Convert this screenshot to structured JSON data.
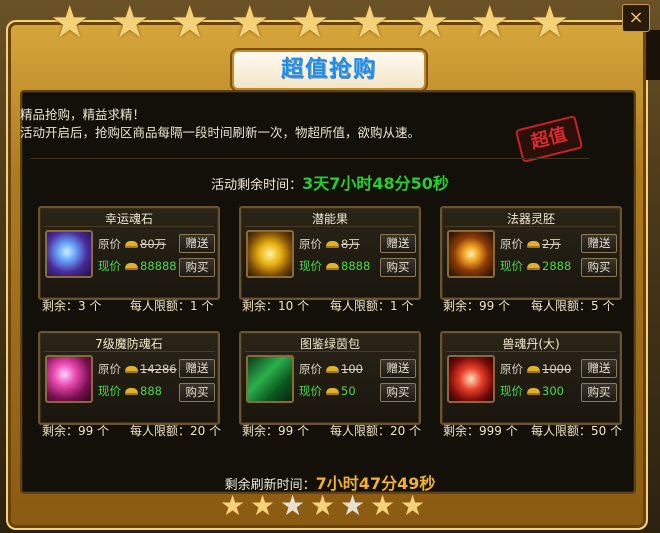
{
  "title": "超值抢购",
  "intro": {
    "line1": "精品抢购，精益求精！",
    "line2": "活动开启后，抢购区商品每隔一段时间刷新一次，物超所值，欲购从速。"
  },
  "stamp": "超值",
  "activity_countdown": {
    "label": "活动剩余时间：",
    "value": "3天7小时48分50秒"
  },
  "refresh_countdown": {
    "label": "剩余刷新时间：",
    "value": "7小时47分49秒"
  },
  "labels": {
    "orig": "原价",
    "now": "现价",
    "gift": "赠送",
    "buy": "购买",
    "remaining": "剩余：",
    "limit": "每人限额："
  },
  "items": [
    {
      "name": "幸运魂石",
      "orig": "80万",
      "now": "88888",
      "remaining": "3 个",
      "limit": "1 个",
      "icon": "crystal-icon"
    },
    {
      "name": "潜能果",
      "orig": "8万",
      "now": "8888",
      "remaining": "10 个",
      "limit": "1 个",
      "icon": "golden-fruit-icon"
    },
    {
      "name": "法器灵胚",
      "orig": "2万",
      "now": "2888",
      "remaining": "99 个",
      "limit": "5 个",
      "icon": "artifact-embryo-icon"
    },
    {
      "name": "7级魔防魂石",
      "orig": "14286",
      "now": "888",
      "remaining": "99 个",
      "limit": "20 个",
      "icon": "pink-gem-icon"
    },
    {
      "name": "图鉴绿茵包",
      "orig": "100",
      "now": "50",
      "remaining": "99 个",
      "limit": "20 个",
      "icon": "green-book-icon"
    },
    {
      "name": "兽魂丹(大)",
      "orig": "1000",
      "now": "300",
      "remaining": "999 个",
      "limit": "50 个",
      "icon": "beast-pill-icon"
    }
  ]
}
